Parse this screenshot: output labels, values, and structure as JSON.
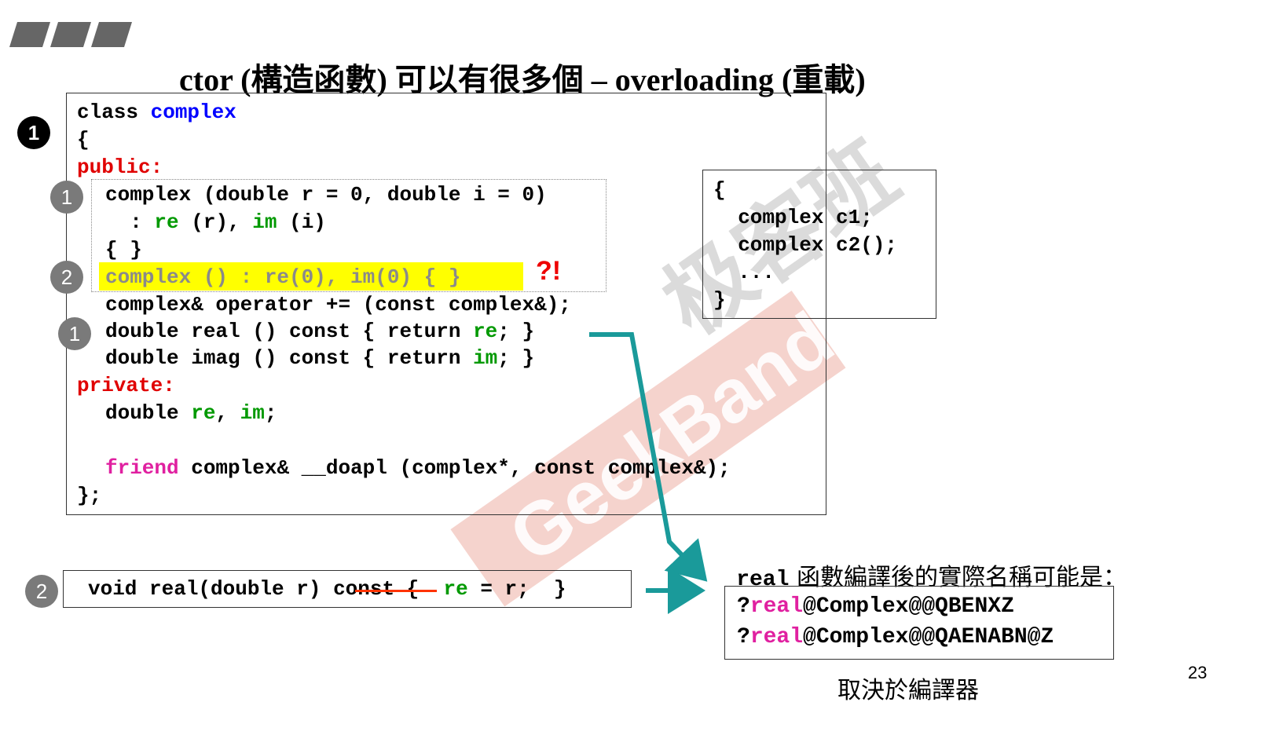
{
  "title": {
    "pre": "ctor (",
    "cjk1": "構造函數",
    "mid": ") ",
    "cjk2": "可以有很多個",
    "post": " – overloading (",
    "cjk3": "重載",
    "end": ")"
  },
  "page_number": "23",
  "badges": {
    "b1": "1",
    "b2": "1",
    "b3": "2",
    "b4": "1",
    "b5": "2"
  },
  "class_box": {
    "l1a": "class ",
    "l1b": "complex",
    "l2": "{",
    "l3": "public:",
    "l4": "complex (double r = 0, double i = 0)",
    "l5a": "  : ",
    "l5b": "re",
    "l5c": " (r), ",
    "l5d": "im",
    "l5e": " (i)",
    "l6": "{ }",
    "l7": "complex () : re(0), im(0) { }",
    "l8": "complex& operator += (const complex&);",
    "l9a": "double real () const { return ",
    "l9b": "re",
    "l9c": "; }",
    "l10a": "double imag () const { return ",
    "l10b": "im",
    "l10c": "; }",
    "l11": "private:",
    "l12a": "double ",
    "l12b": "re",
    "l12c": ", ",
    "l12d": "im",
    "l12e": ";",
    "l13a": "friend",
    "l13b": " complex& __doapl (complex*, const complex&);",
    "l14": "};"
  },
  "warn_mark": "?!",
  "usage_box": {
    "l1": "{",
    "l2": "  complex c1;",
    "l3": "  complex c2();",
    "l4": "  ...",
    "l5": "}"
  },
  "second_def": {
    "a": "void real(double r) ",
    "b": "const",
    "c": " {  ",
    "d": "re",
    "e": " = r;  }"
  },
  "mangled": {
    "caption_code": "real",
    "caption_text": " 函數編譯後的實際名稱可能是：",
    "n1a": "?",
    "n1b": "real",
    "n1c": "@Complex@@QBENXZ",
    "n2a": "?",
    "n2b": "real",
    "n2c": "@Complex@@QAENABN@Z",
    "footer": "取決於編譯器"
  },
  "watermark": {
    "latin": "GeekBand",
    "cjk": "极客班"
  },
  "colors": {
    "arrow": "#1a9a9a",
    "highlight": "#ffff00",
    "strike": "#ff3300"
  }
}
